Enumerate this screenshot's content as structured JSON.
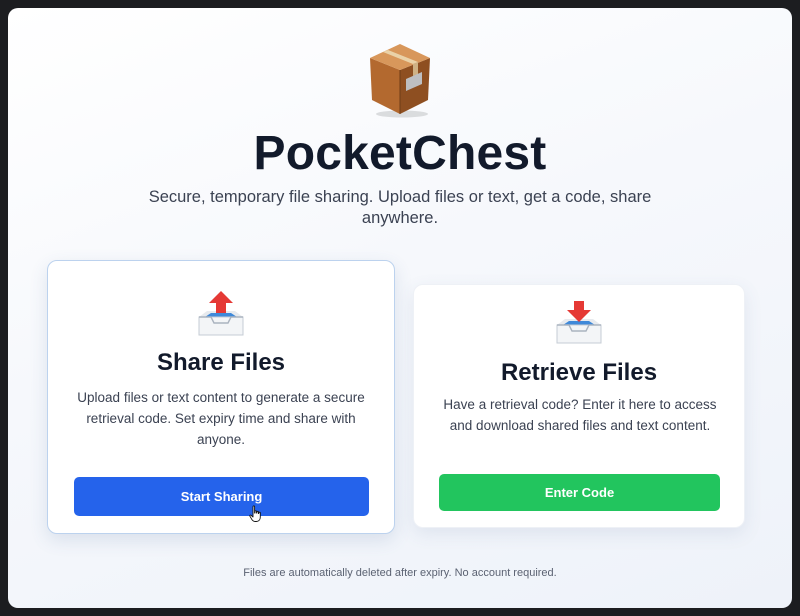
{
  "app": {
    "title": "PocketChest",
    "subtitle": "Secure, temporary file sharing. Upload files or text, get a code, share anywhere.",
    "icon": "package-box-icon"
  },
  "cards": {
    "share": {
      "icon": "outbox-tray-icon",
      "title": "Share Files",
      "description": "Upload files or text content to generate a secure retrieval code. Set expiry time and share with anyone.",
      "button_label": "Start Sharing",
      "button_color": "#2563eb"
    },
    "retrieve": {
      "icon": "inbox-tray-icon",
      "title": "Retrieve Files",
      "description": "Have a retrieval code? Enter it here to access and download shared files and text content.",
      "button_label": "Enter Code",
      "button_color": "#22c55e"
    }
  },
  "footer": {
    "note": "Files are automatically deleted after expiry. No account required."
  }
}
